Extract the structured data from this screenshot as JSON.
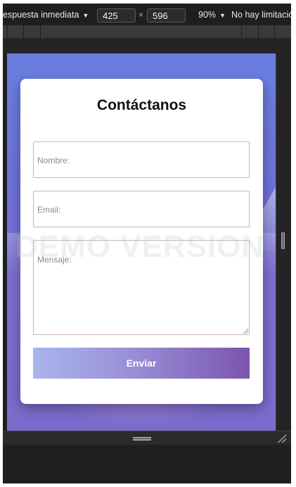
{
  "toolbar": {
    "responsive_label": "espuesta inmediata",
    "caret": "▼",
    "width_value": "425",
    "times_sign": "×",
    "height_value": "596",
    "zoom_label": "90%",
    "throttle_label": "No hay limitació"
  },
  "page": {
    "form_title": "Contáctanos",
    "name_placeholder": "Nombre:",
    "email_placeholder": "Email:",
    "message_placeholder": "Mensaje:",
    "submit_label": "Enviar",
    "watermark": "DEMO VERSION"
  },
  "colors": {
    "button_gradient_start": "#a9b5ec",
    "button_gradient_end": "#7b55ad",
    "field_border": "#c9b1b7",
    "devtools_bg": "#1e1e1e"
  },
  "icons": {
    "right_handle": "vertical-resize-handle-icon",
    "bottom_handle": "horizontal-resize-handle-icon",
    "corner_handle": "corner-resize-icon"
  }
}
